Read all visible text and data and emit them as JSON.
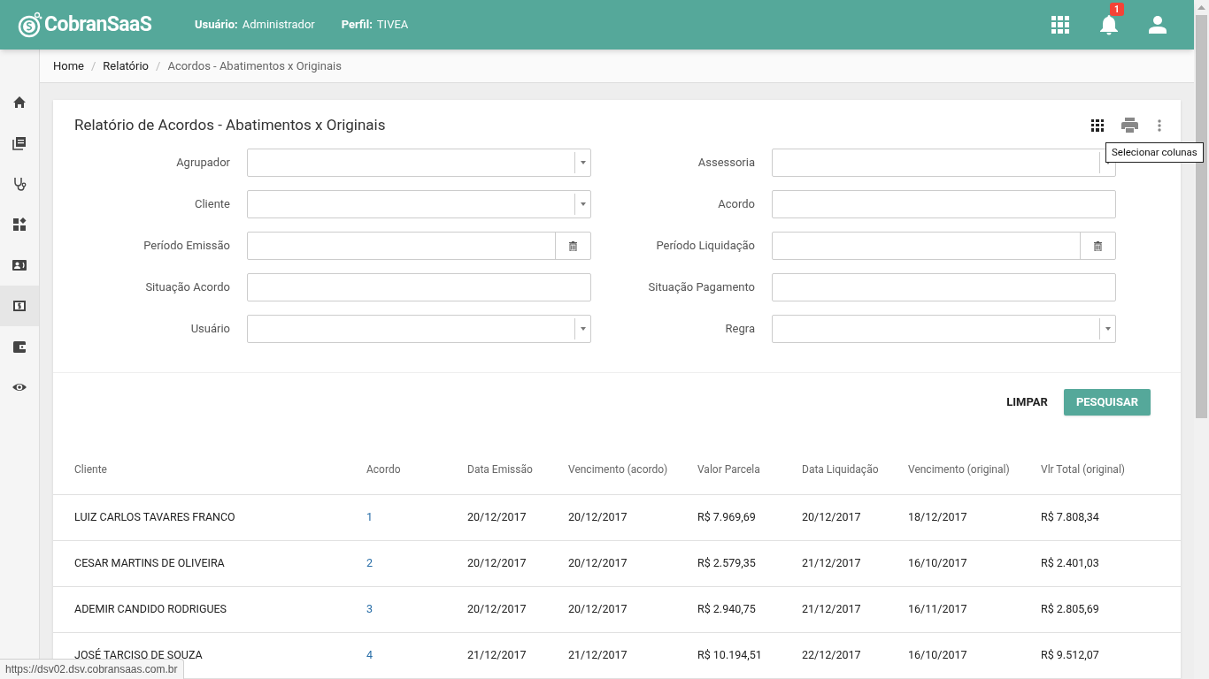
{
  "header": {
    "brand": "CobranSaaS",
    "user_label": "Usuário:",
    "user_value": "Administrador",
    "profile_label": "Perfil:",
    "profile_value": "TIVEA",
    "notification_count": "1"
  },
  "sidebar": {
    "items": [
      {
        "selected": false
      },
      {
        "selected": false
      },
      {
        "selected": false
      },
      {
        "selected": false
      },
      {
        "selected": false
      },
      {
        "selected": true
      },
      {
        "selected": false
      },
      {
        "selected": false
      }
    ]
  },
  "breadcrumb": [
    {
      "kind": "link",
      "label": "Home"
    },
    {
      "kind": "separator",
      "label": "/"
    },
    {
      "kind": "link",
      "label": "Relatório"
    },
    {
      "kind": "separator",
      "label": "/"
    },
    {
      "kind": "current",
      "label": "Acordos - Abatimentos x Originais"
    }
  ],
  "card": {
    "title": "Relatório de Acordos - Abatimentos x Originais",
    "tooltip": "Selecionar colunas"
  },
  "filters": [
    {
      "label": "Agrupador",
      "kind": "select"
    },
    {
      "label": "Assessoria",
      "kind": "select"
    },
    {
      "label": "Cliente",
      "kind": "select"
    },
    {
      "label": "Acordo",
      "kind": "text"
    },
    {
      "label": "Período Emissão",
      "kind": "date"
    },
    {
      "label": "Período Liquidação",
      "kind": "date"
    },
    {
      "label": "Situação Acordo",
      "kind": "text"
    },
    {
      "label": "Situação Pagamento",
      "kind": "text"
    },
    {
      "label": "Usuário",
      "kind": "select"
    },
    {
      "label": "Regra",
      "kind": "select"
    }
  ],
  "buttons": {
    "clear": "LIMPAR",
    "search": "PESQUISAR"
  },
  "table": {
    "columns": [
      "Cliente",
      "Acordo",
      "Data Emissão",
      "Vencimento (acordo)",
      "Valor Parcela",
      "Data Liquidação",
      "Vencimento (original)",
      "Vlr Total (original)"
    ],
    "rows": [
      [
        "LUIZ CARLOS TAVARES FRANCO",
        "1",
        "20/12/2017",
        "20/12/2017",
        "R$ 7.969,69",
        "20/12/2017",
        "18/12/2017",
        "R$ 7.808,34"
      ],
      [
        "CESAR MARTINS DE OLIVEIRA",
        "2",
        "20/12/2017",
        "20/12/2017",
        "R$ 2.579,35",
        "21/12/2017",
        "16/10/2017",
        "R$ 2.401,03"
      ],
      [
        "ADEMIR CANDIDO RODRIGUES",
        "3",
        "20/12/2017",
        "20/12/2017",
        "R$ 2.940,75",
        "21/12/2017",
        "16/11/2017",
        "R$ 2.805,69"
      ],
      [
        "JOSÉ TARCISO DE SOUZA",
        "4",
        "21/12/2017",
        "21/12/2017",
        "R$ 10.194,51",
        "22/12/2017",
        "16/10/2017",
        "R$ 9.512,07"
      ]
    ]
  },
  "status_url": "https://dsv02.dsv.cobransaas.com.br"
}
